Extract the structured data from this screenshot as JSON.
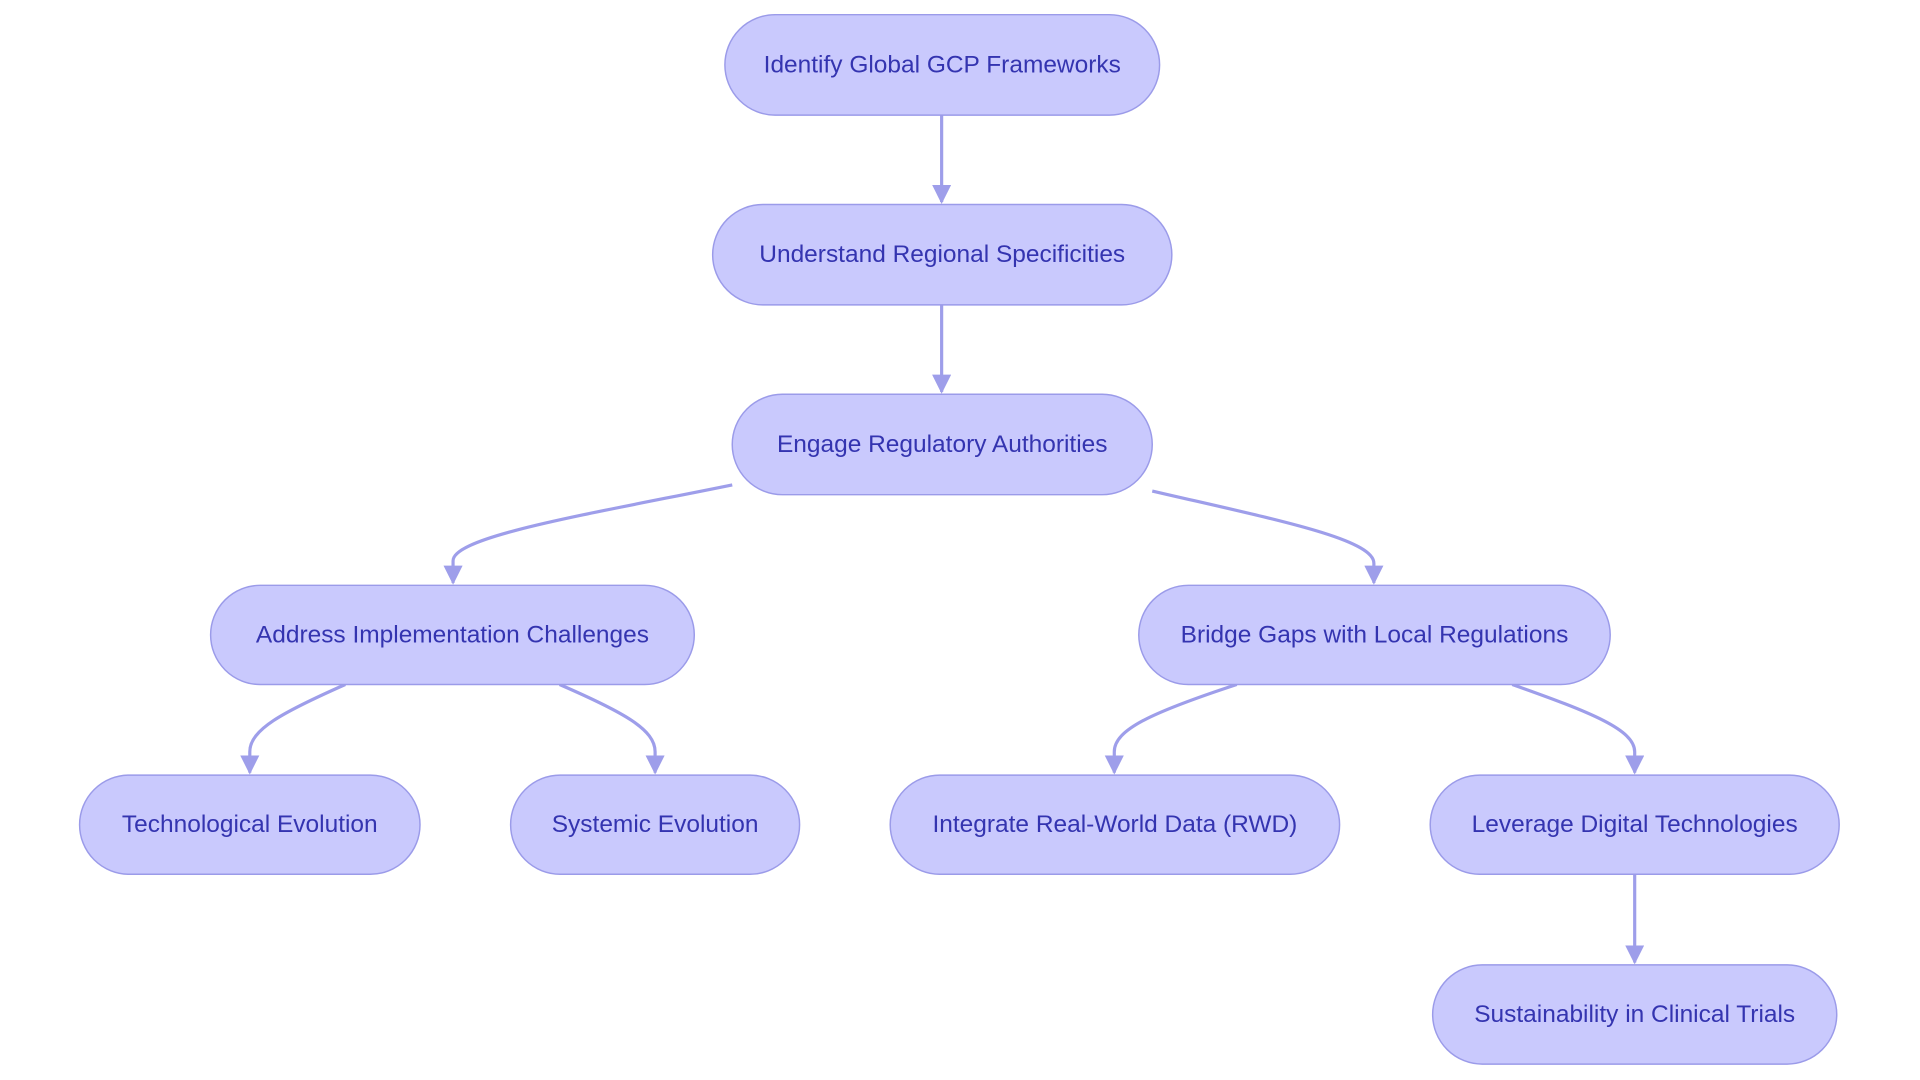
{
  "diagram": {
    "type": "flowchart",
    "direction": "top-down",
    "colors": {
      "node_fill": "#c9c9fd",
      "node_stroke": "#9b9be9",
      "text": "#3434b0",
      "edge": "#9e9eea"
    },
    "nodes": [
      {
        "id": "n1",
        "label": "Identify Global GCP Frameworks"
      },
      {
        "id": "n2",
        "label": "Understand Regional Specificities"
      },
      {
        "id": "n3",
        "label": "Engage Regulatory Authorities"
      },
      {
        "id": "n4",
        "label": "Address Implementation Challenges"
      },
      {
        "id": "n5",
        "label": "Bridge Gaps with Local Regulations"
      },
      {
        "id": "n6",
        "label": "Technological Evolution"
      },
      {
        "id": "n7",
        "label": "Systemic Evolution"
      },
      {
        "id": "n8",
        "label": "Integrate Real-World Data (RWD)"
      },
      {
        "id": "n9",
        "label": "Leverage Digital Technologies"
      },
      {
        "id": "n10",
        "label": "Sustainability in Clinical Trials"
      }
    ],
    "edges": [
      {
        "from": "n1",
        "to": "n2"
      },
      {
        "from": "n2",
        "to": "n3"
      },
      {
        "from": "n3",
        "to": "n4"
      },
      {
        "from": "n3",
        "to": "n5"
      },
      {
        "from": "n4",
        "to": "n6"
      },
      {
        "from": "n4",
        "to": "n7"
      },
      {
        "from": "n5",
        "to": "n8"
      },
      {
        "from": "n5",
        "to": "n9"
      },
      {
        "from": "n9",
        "to": "n10"
      }
    ]
  }
}
